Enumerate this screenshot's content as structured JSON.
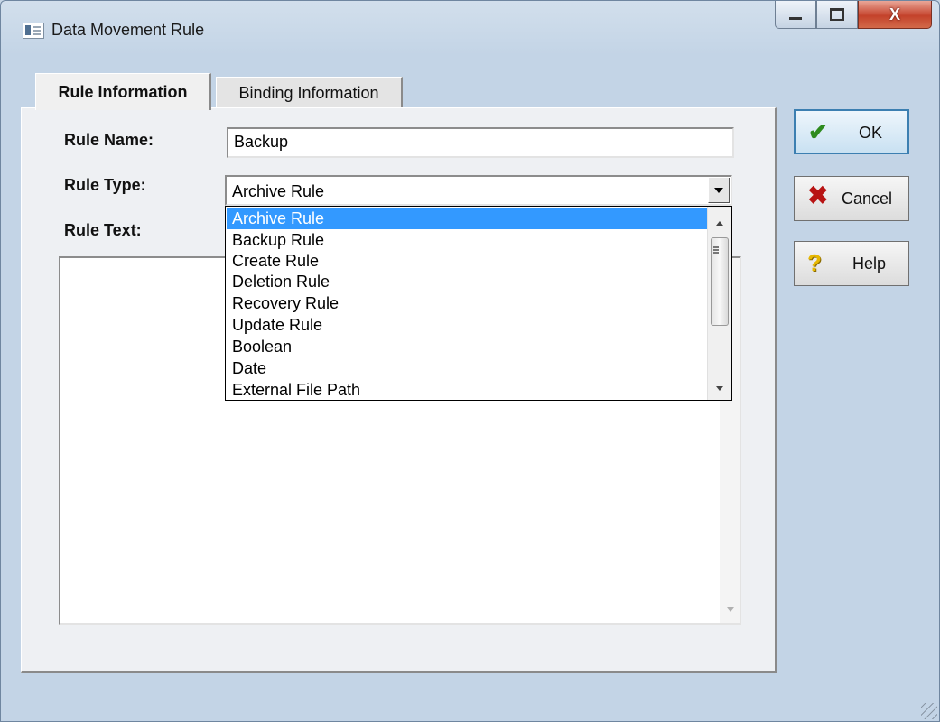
{
  "window": {
    "title": "Data Movement Rule",
    "icon": "app-window-icon",
    "controls": [
      "minimize-icon",
      "maximize-icon",
      "close-icon"
    ],
    "close_glyph": "X"
  },
  "tabs": [
    {
      "label": "Rule Information",
      "active": true
    },
    {
      "label": "Binding Information",
      "active": false
    }
  ],
  "form": {
    "rule_name_label": "Rule Name:",
    "rule_name_value": "Backup",
    "rule_type_label": "Rule Type:",
    "rule_type_value": "Archive Rule",
    "rule_text_label": "Rule Text:",
    "rule_text_value": ""
  },
  "dropdown": {
    "options": [
      "Archive Rule",
      "Backup Rule",
      "Create Rule",
      "Deletion Rule",
      "Recovery Rule",
      "Update Rule",
      "Boolean",
      "Date",
      "External File Path"
    ],
    "selected_index": 0
  },
  "buttons": {
    "ok": {
      "label": "OK",
      "icon": "checkmark-icon"
    },
    "cancel": {
      "label": "Cancel",
      "icon": "x-icon"
    },
    "help": {
      "label": "Help",
      "icon": "question-icon"
    }
  },
  "colors": {
    "selection": "#3399ff",
    "close_button": "#c4422b",
    "window_frame": "#c3d4e6"
  }
}
